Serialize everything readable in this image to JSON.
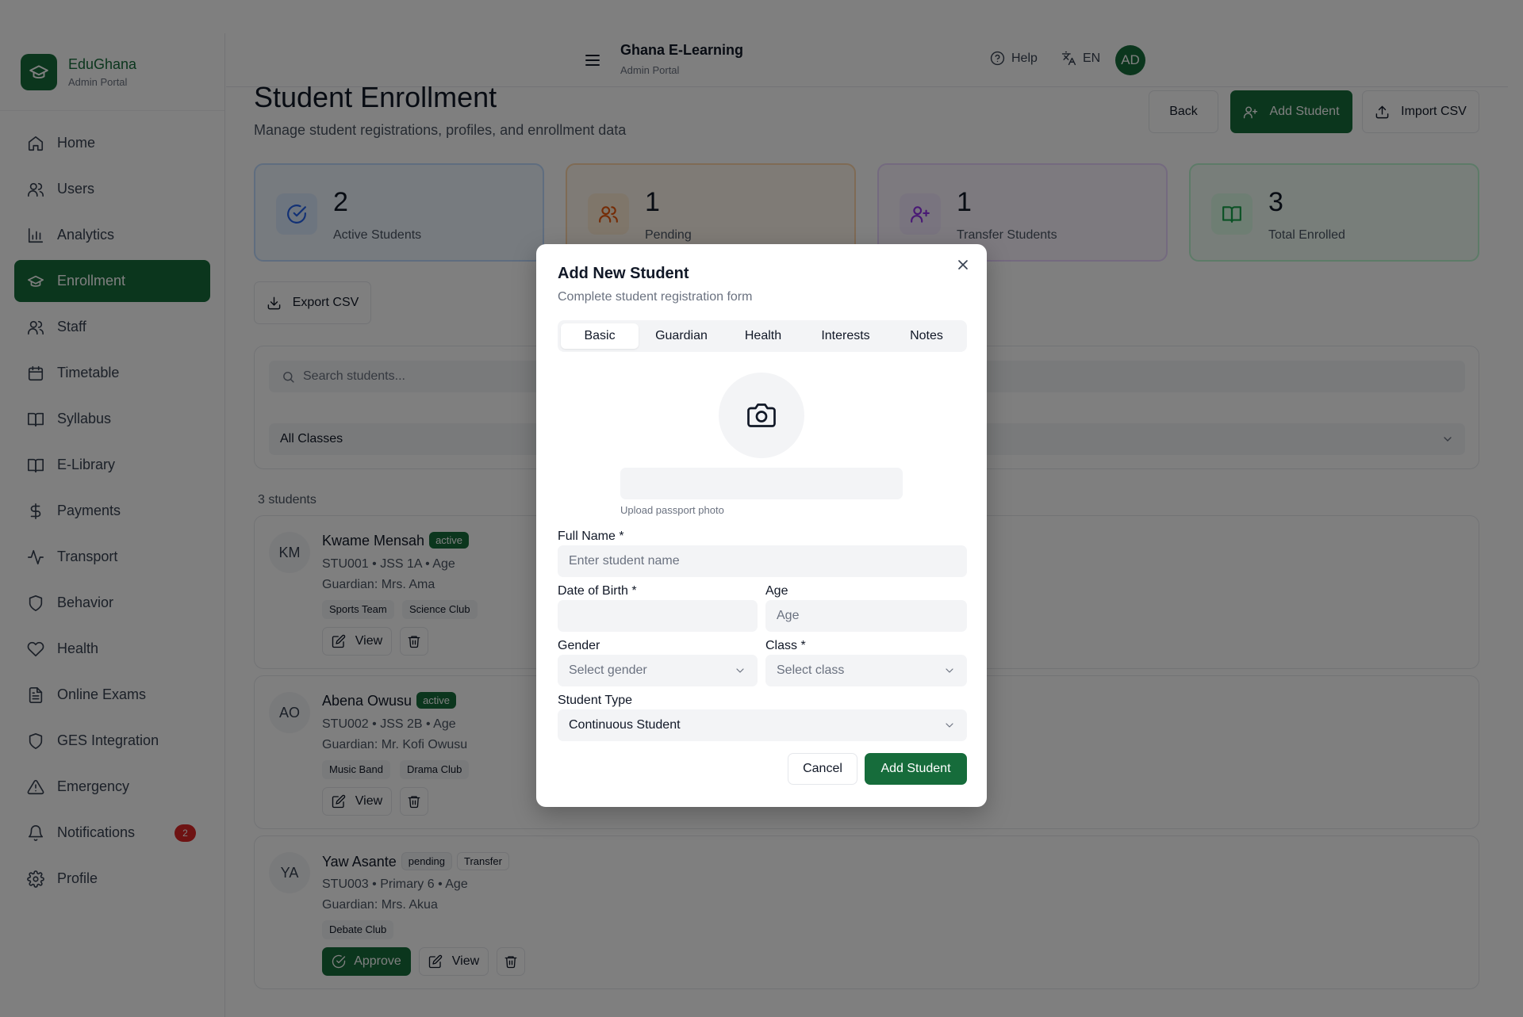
{
  "brand": {
    "name": "EduGhana",
    "subtitle": "Admin Portal"
  },
  "sidebar": {
    "items": [
      {
        "label": "Home",
        "icon": "home-icon"
      },
      {
        "label": "Users",
        "icon": "users-icon"
      },
      {
        "label": "Analytics",
        "icon": "bar-chart-icon"
      },
      {
        "label": "Enrollment",
        "icon": "graduation-cap-icon",
        "active": true
      },
      {
        "label": "Staff",
        "icon": "users-icon"
      },
      {
        "label": "Timetable",
        "icon": "calendar-icon"
      },
      {
        "label": "Syllabus",
        "icon": "book-open-icon"
      },
      {
        "label": "E-Library",
        "icon": "book-open-icon"
      },
      {
        "label": "Payments",
        "icon": "dollar-icon"
      },
      {
        "label": "Transport",
        "icon": "activity-icon"
      },
      {
        "label": "Behavior",
        "icon": "shield-icon"
      },
      {
        "label": "Health",
        "icon": "heart-icon"
      },
      {
        "label": "Online Exams",
        "icon": "file-text-icon"
      },
      {
        "label": "GES Integration",
        "icon": "shield-icon"
      },
      {
        "label": "Emergency",
        "icon": "alert-triangle-icon"
      },
      {
        "label": "Notifications",
        "icon": "bell-icon",
        "badge": "2"
      },
      {
        "label": "Profile",
        "icon": "settings-icon"
      }
    ]
  },
  "header": {
    "title": "Ghana E-Learning",
    "subtitle": "Admin Portal",
    "help_label": "Help",
    "lang_label": "EN",
    "avatar_initials": "AD"
  },
  "page": {
    "title": "Student Enrollment",
    "subtitle": "Manage student registrations, profiles, and enrollment data",
    "back_label": "Back",
    "add_label": "Add Student",
    "import_label": "Import CSV",
    "export_label": "Export CSV"
  },
  "stats": [
    {
      "value": "2",
      "label": "Active Students",
      "color": "#2563eb"
    },
    {
      "value": "1",
      "label": "Pending",
      "color": "#ea580c"
    },
    {
      "value": "1",
      "label": "Transfer Students",
      "color": "#9333ea"
    },
    {
      "value": "3",
      "label": "Total Enrolled",
      "color": "#16a34a"
    }
  ],
  "filters": {
    "search_placeholder": "Search students...",
    "class_filter": "All Classes"
  },
  "list": {
    "count_label": "3 students",
    "students": [
      {
        "initials": "KM",
        "name": "Kwame Mensah",
        "status": "active",
        "details": "STU001 • JSS 1A • Age",
        "guardian": "Guardian: Mrs. Ama",
        "tags": [
          "Sports Team",
          "Science Club"
        ],
        "view_label": "View"
      },
      {
        "initials": "AO",
        "name": "Abena Owusu",
        "status": "active",
        "details": "STU002 • JSS 2B • Age",
        "guardian": "Guardian: Mr. Kofi Owusu",
        "tags": [
          "Music Band",
          "Drama Club"
        ],
        "view_label": "View"
      },
      {
        "initials": "YA",
        "name": "Yaw Asante",
        "status": "pending",
        "type": "Transfer",
        "details": "STU003 • Primary 6 • Age",
        "guardian": "Guardian: Mrs. Akua",
        "tags": [
          "Debate Club"
        ],
        "approve_label": "Approve",
        "view_label": "View"
      }
    ]
  },
  "modal": {
    "title": "Add New Student",
    "subtitle": "Complete student registration form",
    "tabs": [
      "Basic",
      "Guardian",
      "Health",
      "Interests",
      "Notes"
    ],
    "photo_hint": "Upload passport photo",
    "full_name_label": "Full Name *",
    "full_name_placeholder": "Enter student name",
    "dob_label": "Date of Birth *",
    "age_label": "Age",
    "age_placeholder": "Age",
    "gender_label": "Gender",
    "gender_placeholder": "Select gender",
    "class_label": "Class *",
    "class_placeholder": "Select class",
    "type_label": "Student Type",
    "type_value": "Continuous Student",
    "cancel_label": "Cancel",
    "submit_label": "Add Student"
  }
}
